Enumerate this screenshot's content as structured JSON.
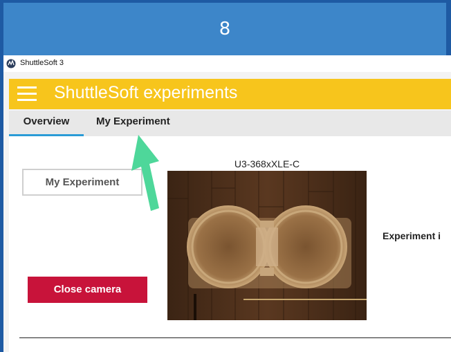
{
  "step_header": {
    "number": "8"
  },
  "window": {
    "title": "ShuttleSoft 3"
  },
  "appbar": {
    "title": "ShuttleSoft experiments",
    "menu_icon": "hamburger-menu-icon"
  },
  "tabs": [
    {
      "label": "Overview",
      "selected": true
    },
    {
      "label": "My Experiment",
      "selected": false
    }
  ],
  "main": {
    "experiment_button_label": "My Experiment",
    "close_camera_label": "Close camera",
    "camera_name": "U3-368xXLE-C",
    "experiment_info_text": "Experiment i"
  },
  "annotation": {
    "arrow_icon": "green-up-arrow-icon"
  },
  "colors": {
    "header_blue": "#3d86c9",
    "appbar_yellow": "#f7c51c",
    "tab_underline": "#2a9bd6",
    "close_button_red": "#c8133a",
    "arrow_green": "#4ed79a"
  }
}
